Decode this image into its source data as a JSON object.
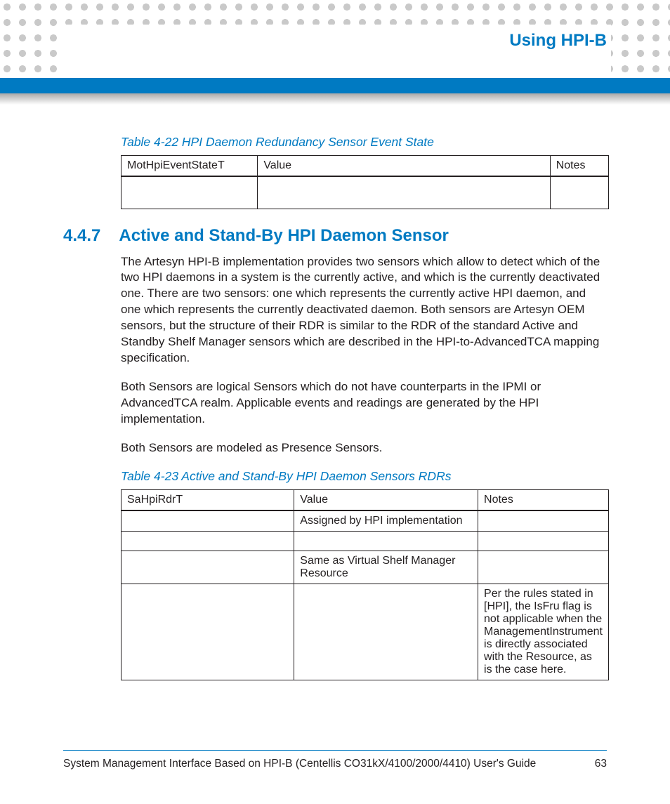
{
  "header": {
    "chapter_title": "Using HPI-B"
  },
  "table422": {
    "caption": "Table 4-22 HPI Daemon Redundancy Sensor Event State",
    "head": {
      "c1": "MotHpiEventStateT",
      "c2": "Value",
      "c3": "Notes"
    },
    "rows": [
      {
        "c1": "",
        "c2": "",
        "c3": ""
      }
    ]
  },
  "section": {
    "number": "4.4.7",
    "title": "Active and Stand-By HPI Daemon Sensor",
    "p1": "The Artesyn HPI-B implementation provides two sensors which allow to detect which of the two HPI daemons in a system is the currently active, and which is the currently deactivated one. There are two sensors: one which represents the currently active HPI daemon, and one which represents the currently deactivated daemon. Both sensors are Artesyn OEM sensors, but the structure of their RDR is similar to the RDR of the standard Active and Standby Shelf Manager sensors which are described in the HPI-to-AdvancedTCA mapping specification.",
    "p2": "Both Sensors are logical Sensors which do not have counterparts in the IPMI or AdvancedTCA realm. Applicable events and readings are generated by the HPI implementation.",
    "p3": "Both Sensors are modeled as Presence Sensors."
  },
  "table423": {
    "caption": "Table 4-23 Active and Stand-By HPI Daemon Sensors RDRs",
    "head": {
      "c1": "SaHpiRdrT",
      "c2": "Value",
      "c3": "Notes"
    },
    "rows": [
      {
        "c1": "",
        "c2": "Assigned by HPI implementation",
        "c3": ""
      },
      {
        "c1": "",
        "c2": "",
        "c3": ""
      },
      {
        "c1": "",
        "c2": "Same as Virtual Shelf Manager Resource",
        "c3": ""
      },
      {
        "c1": "",
        "c2": "",
        "c3": "Per the rules stated in [HPI], the IsFru flag is not applicable when the ManagementInstrument is directly associated with the Resource, as is the case here."
      }
    ]
  },
  "footer": {
    "doc_title": "System Management Interface Based on HPI-B (Centellis CO31kX/4100/2000/4410) User's Guide",
    "page_number": "63"
  }
}
